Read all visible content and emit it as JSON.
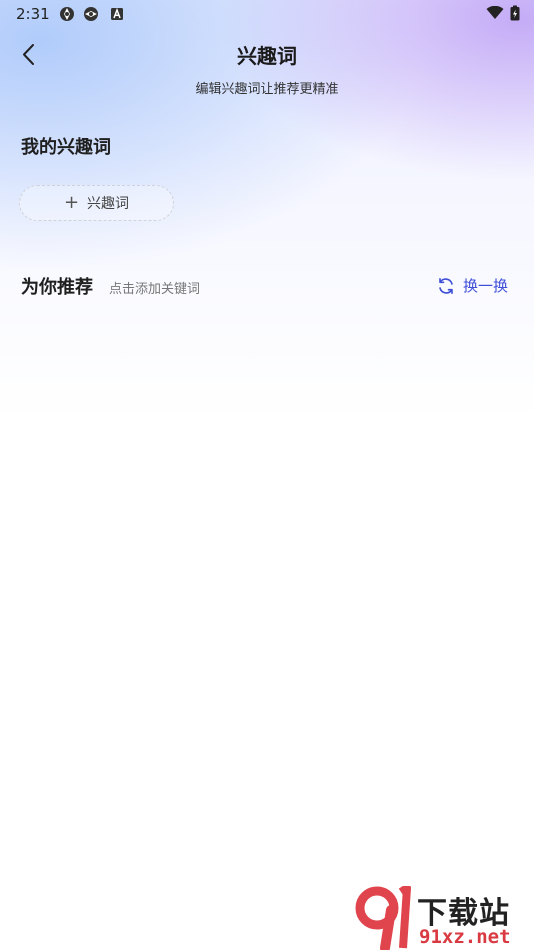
{
  "status_bar": {
    "time": "2:31",
    "icons": [
      "aperture-icon",
      "aperture-icon",
      "a-box-icon",
      "wifi-icon",
      "battery-charging-icon"
    ]
  },
  "header": {
    "title": "兴趣词",
    "subtitle": "编辑兴趣词让推荐更精准"
  },
  "my_interests": {
    "title": "我的兴趣词",
    "add_chip_label": "兴趣词"
  },
  "recommend": {
    "title": "为你推荐",
    "hint": "点击添加关键词",
    "refresh_label": "换一换"
  },
  "watermark": {
    "cn_text": "下载站",
    "en_text": "91xz.net"
  },
  "colors": {
    "accent": "#3f4fd8",
    "watermark_red": "#d93a42"
  }
}
